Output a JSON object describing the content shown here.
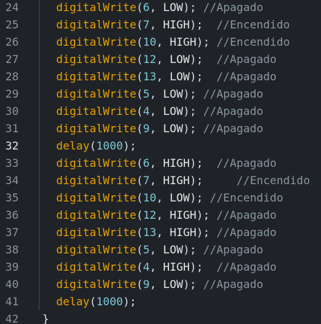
{
  "colors": {
    "background": "#1f2328",
    "function": "#e8a000",
    "number": "#7ec8d8",
    "constant": "#e6e6e6",
    "comment": "#8a95a0",
    "line_number": "#8b939b",
    "current_line_number": "#e6e6e6"
  },
  "editor": {
    "current_line": "32",
    "closing_brace": "}",
    "lines": [
      {
        "num": "24",
        "fn": "digitalWrite",
        "open": "(",
        "arg": "6",
        "sep": ", ",
        "val": "LOW",
        "close": ");",
        "gap": " ",
        "comment": "//Apagado"
      },
      {
        "num": "25",
        "fn": "digitalWrite",
        "open": "(",
        "arg": "7",
        "sep": ", ",
        "val": "HIGH",
        "close": ");",
        "gap": "  ",
        "comment": "//Encendido"
      },
      {
        "num": "26",
        "fn": "digitalWrite",
        "open": "(",
        "arg": "10",
        "sep": ", ",
        "val": "HIGH",
        "close": ");",
        "gap": " ",
        "comment": "//Encendido"
      },
      {
        "num": "27",
        "fn": "digitalWrite",
        "open": "(",
        "arg": "12",
        "sep": ", ",
        "val": "LOW",
        "close": ");",
        "gap": "  ",
        "comment": "//Apagado"
      },
      {
        "num": "28",
        "fn": "digitalWrite",
        "open": "(",
        "arg": "13",
        "sep": ", ",
        "val": "LOW",
        "close": ");",
        "gap": "  ",
        "comment": "//Apagado"
      },
      {
        "num": "29",
        "fn": "digitalWrite",
        "open": "(",
        "arg": "5",
        "sep": ", ",
        "val": "LOW",
        "close": ");",
        "gap": " ",
        "comment": "//Apagado"
      },
      {
        "num": "30",
        "fn": "digitalWrite",
        "open": "(",
        "arg": "4",
        "sep": ", ",
        "val": "LOW",
        "close": ");",
        "gap": " ",
        "comment": "//Apagado"
      },
      {
        "num": "31",
        "fn": "digitalWrite",
        "open": "(",
        "arg": "9",
        "sep": ", ",
        "val": "LOW",
        "close": ");",
        "gap": " ",
        "comment": "//Apagado"
      },
      {
        "num": "32",
        "fn": "delay",
        "open": "(",
        "arg": "1000",
        "sep": "",
        "val": "",
        "close": ");",
        "gap": "",
        "comment": ""
      },
      {
        "num": "33",
        "fn": "digitalWrite",
        "open": "(",
        "arg": "6",
        "sep": ", ",
        "val": "HIGH",
        "close": ");",
        "gap": "  ",
        "comment": "//Apagado"
      },
      {
        "num": "34",
        "fn": "digitalWrite",
        "open": "(",
        "arg": "7",
        "sep": ", ",
        "val": "HIGH",
        "close": ");",
        "gap": "     ",
        "comment": "//Encendido"
      },
      {
        "num": "35",
        "fn": "digitalWrite",
        "open": "(",
        "arg": "10",
        "sep": ", ",
        "val": "LOW",
        "close": ");",
        "gap": " ",
        "comment": "//Encendido"
      },
      {
        "num": "36",
        "fn": "digitalWrite",
        "open": "(",
        "arg": "12",
        "sep": ", ",
        "val": "HIGH",
        "close": ");",
        "gap": " ",
        "comment": "//Apagado"
      },
      {
        "num": "37",
        "fn": "digitalWrite",
        "open": "(",
        "arg": "13",
        "sep": ", ",
        "val": "HIGH",
        "close": ");",
        "gap": " ",
        "comment": "//Apagado"
      },
      {
        "num": "38",
        "fn": "digitalWrite",
        "open": "(",
        "arg": "5",
        "sep": ", ",
        "val": "LOW",
        "close": ");",
        "gap": " ",
        "comment": "//Apagado"
      },
      {
        "num": "39",
        "fn": "digitalWrite",
        "open": "(",
        "arg": "4",
        "sep": ", ",
        "val": "HIGH",
        "close": ");",
        "gap": "  ",
        "comment": "//Apagado"
      },
      {
        "num": "40",
        "fn": "digitalWrite",
        "open": "(",
        "arg": "9",
        "sep": ", ",
        "val": "LOW",
        "close": ");",
        "gap": " ",
        "comment": "//Apagado"
      },
      {
        "num": "41",
        "fn": "delay",
        "open": "(",
        "arg": "1000",
        "sep": "",
        "val": "",
        "close": ");",
        "gap": "",
        "comment": ""
      },
      {
        "num": "42",
        "brace": true
      }
    ]
  }
}
